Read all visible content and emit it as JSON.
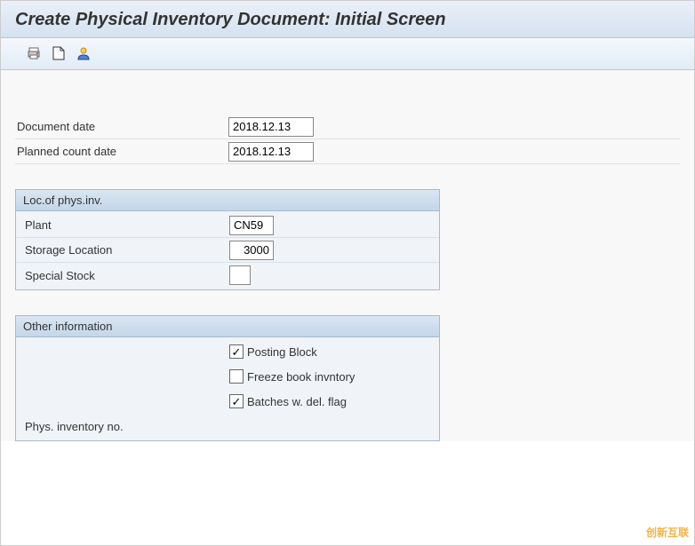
{
  "title": "Create Physical Inventory Document: Initial Screen",
  "dates": {
    "document_date_label": "Document date",
    "document_date_value": "2018.12.13",
    "planned_count_date_label": "Planned count date",
    "planned_count_date_value": "2018.12.13"
  },
  "location_group": {
    "header": "Loc.of phys.inv.",
    "plant_label": "Plant",
    "plant_value": "CN59",
    "storage_location_label": "Storage Location",
    "storage_location_value": "3000",
    "special_stock_label": "Special Stock",
    "special_stock_value": ""
  },
  "other_group": {
    "header": "Other information",
    "posting_block_label": "Posting Block",
    "posting_block_checked": "✓",
    "freeze_book_label": "Freeze book invntory",
    "freeze_book_checked": "",
    "batches_del_label": "Batches w. del. flag",
    "batches_del_checked": "✓",
    "phys_inv_no_label": "Phys. inventory no."
  },
  "watermark": "创新互联"
}
